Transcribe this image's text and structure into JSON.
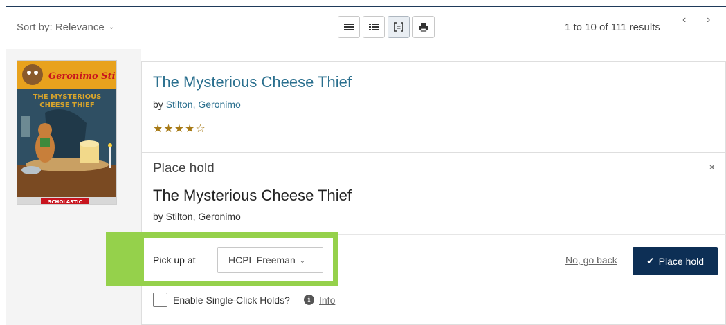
{
  "toolbar": {
    "sort_label": "Sort by: Relevance",
    "results_text": "1 to 10 of 111 results",
    "prev_glyph": "‹",
    "next_glyph": "›",
    "view_buttons": [
      "list-view-icon",
      "list-details-icon",
      "expanded-view-icon",
      "print-icon"
    ]
  },
  "book": {
    "title": "The Mysterious Cheese Thief",
    "author_prefix": "by ",
    "author": "Stilton, Geronimo",
    "rating_stars": "★★★★☆",
    "rating": 4,
    "cover": {
      "series": "Geronimo Stilton",
      "title_line1": "THE MYSTERIOUS",
      "title_line2": "CHEESE THIEF",
      "publisher": "SCHOLASTIC"
    }
  },
  "hold_form": {
    "heading": "Place hold",
    "close_glyph": "×",
    "title": "The Mysterious Cheese Thief",
    "author_line": "by Stilton, Geronimo",
    "pickup_label": "Pick up at",
    "pickup_value": "HCPL Freeman",
    "go_back_label": "No, go back",
    "place_hold_label": "Place hold",
    "single_click_label": "Enable Single-Click Holds?",
    "info_label": "Info"
  },
  "colors": {
    "accent_dark": "#0d2f55",
    "link": "#2a6f8e",
    "highlight": "#95d14b",
    "star": "#a77a16"
  }
}
